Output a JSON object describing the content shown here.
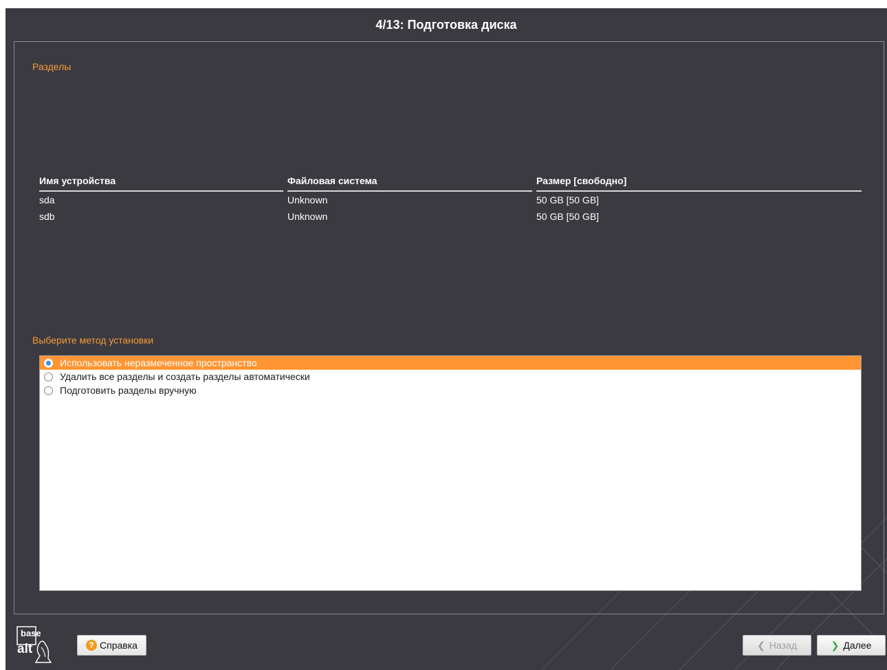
{
  "window": {
    "title": "4/13: Подготовка диска"
  },
  "partitions": {
    "title": "Разделы",
    "columns": [
      "Имя устройства",
      "Файловая система",
      "Размер [свободно]"
    ],
    "rows": [
      [
        "sda",
        "Unknown",
        "50 GB [50 GB]"
      ],
      [
        "sdb",
        "Unknown",
        "50 GB [50 GB]"
      ]
    ]
  },
  "method": {
    "title": "Выберите метод установки",
    "options": [
      {
        "label": "Использовать неразмеченное пространство",
        "selected": true
      },
      {
        "label": "Удалить все разделы и создать разделы автоматически",
        "selected": false
      },
      {
        "label": "Подготовить разделы вручную",
        "selected": false
      }
    ]
  },
  "footer": {
    "logo_text_top": "base",
    "logo_text_bottom": "alt",
    "help_label": "Справка",
    "back_label": "Назад",
    "next_label": "Далее"
  },
  "colors": {
    "accent": "#f59a3a",
    "selection": "#ff9533",
    "background": "#3b3a40"
  }
}
